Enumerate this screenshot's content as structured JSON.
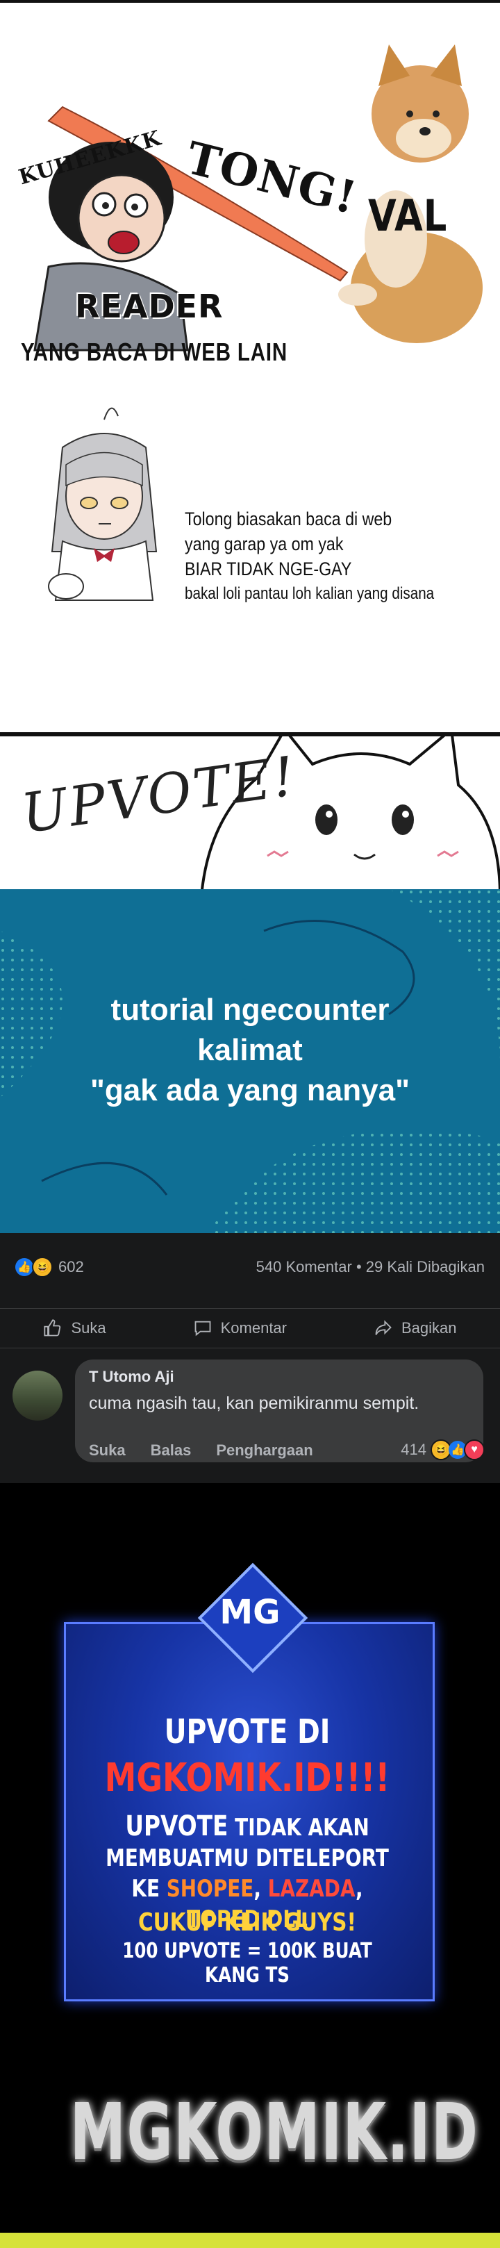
{
  "panel_reader": {
    "sfx_kuheekk": "KUHEEKKK",
    "sfx_tong": "TONG!",
    "label_val": "VAL",
    "label_reader": "READER",
    "caption": "YANG BACA DI WEB LAIN"
  },
  "panel_loli": {
    "lines": [
      "Tolong biasakan baca di web",
      "yang garap ya om yak",
      "BIAR TIDAK NGE-GAY",
      "bakal loli pantau loh kalian yang disana"
    ]
  },
  "panel_upvote": {
    "handwritten": "UPVOTE!"
  },
  "panel_tutorial": {
    "lines": [
      "tutorial ngecounter",
      "kalimat",
      "\"gak ada yang nanya\""
    ],
    "colors": {
      "background": "#0f6f95",
      "dots": "#7fd6c5"
    }
  },
  "fb_post": {
    "reaction_count": "602",
    "stats": "540 Komentar • 29 Kali Dibagikan",
    "actions": {
      "like": "Suka",
      "comment": "Komentar",
      "share": "Bagikan"
    },
    "comment": {
      "author": "T Utomo Aji",
      "text": "cuma ngasih tau, kan pemikiranmu sempit.",
      "actions": [
        "Suka",
        "Balas",
        "Penghargaan"
      ],
      "reaction_count": "414"
    },
    "icons": {
      "like": "thumbs-up-icon",
      "comment": "speech-bubble-icon",
      "share": "share-arrow-icon"
    }
  },
  "banner": {
    "logo": "MG",
    "line1": "UPVOTE DI",
    "line2": "MGKOMIK.ID!!!!",
    "line3_a": "UPVOTE",
    "line3_b": " TIDAK AKAN",
    "line4": "MEMBUATMU DITELEPORT",
    "line5_ke": "KE ",
    "line5_shopee": "SHOPEE",
    "line5_lazada": "LAZADA",
    "line5_toped": "TOPED DLL",
    "line6": "CUKUP KLIK GUYS!",
    "line7": "100 UPVOTE = 100K BUAT KANG TS",
    "footer": "MGKOMIK.ID"
  }
}
